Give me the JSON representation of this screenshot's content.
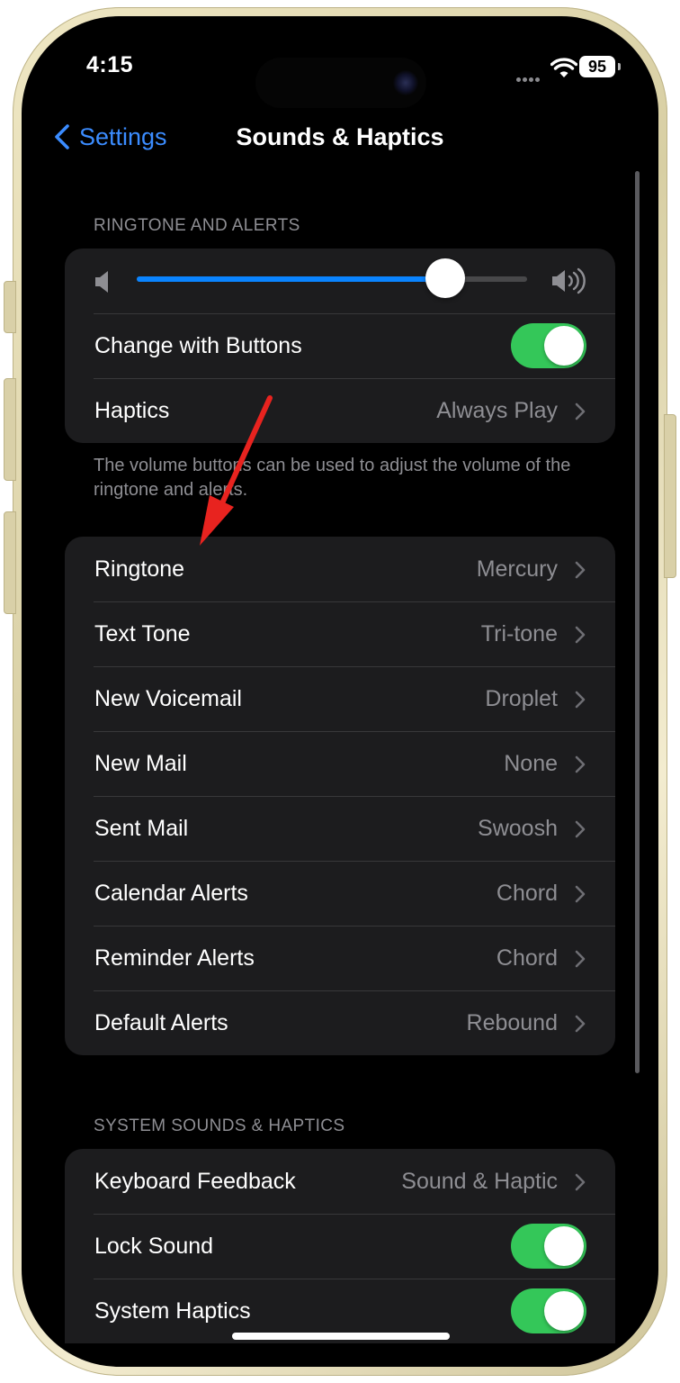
{
  "status_bar": {
    "time": "4:15",
    "battery": "95"
  },
  "nav": {
    "back_label": "Settings",
    "title": "Sounds & Haptics"
  },
  "ringtone_section": {
    "header": "RINGTONE AND ALERTS",
    "volume_level": 0.79,
    "change_with_buttons": {
      "label": "Change with Buttons",
      "on": true
    },
    "haptics": {
      "label": "Haptics",
      "value": "Always Play"
    },
    "footer": "The volume buttons can be used to adjust the volume of the ringtone and alerts."
  },
  "tones": [
    {
      "label": "Ringtone",
      "value": "Mercury"
    },
    {
      "label": "Text Tone",
      "value": "Tri-tone"
    },
    {
      "label": "New Voicemail",
      "value": "Droplet"
    },
    {
      "label": "New Mail",
      "value": "None"
    },
    {
      "label": "Sent Mail",
      "value": "Swoosh"
    },
    {
      "label": "Calendar Alerts",
      "value": "Chord"
    },
    {
      "label": "Reminder Alerts",
      "value": "Chord"
    },
    {
      "label": "Default Alerts",
      "value": "Rebound"
    }
  ],
  "system_section": {
    "header": "SYSTEM SOUNDS & HAPTICS",
    "keyboard_feedback": {
      "label": "Keyboard Feedback",
      "value": "Sound & Haptic"
    },
    "lock_sound": {
      "label": "Lock Sound",
      "on": true
    },
    "system_haptics": {
      "label": "System Haptics",
      "on": true
    }
  },
  "colors": {
    "accent": "#0a84ff",
    "toggle_on": "#34c759",
    "annotation_arrow": "#e8231f",
    "background": "#000000",
    "cell": "#1c1c1e"
  },
  "icons": {
    "back": "chevron-left-icon",
    "chevron": "chevron-right-icon",
    "volume_low": "speaker-icon",
    "volume_high": "speaker-wave-icon",
    "wifi": "wifi-icon",
    "battery": "battery-icon"
  }
}
